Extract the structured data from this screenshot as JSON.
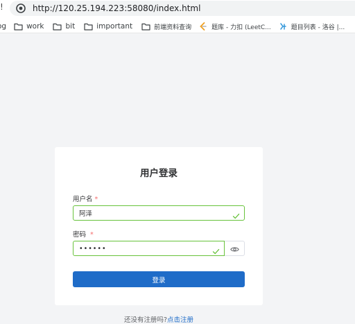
{
  "browser": {
    "left_edge_glyph": "!",
    "url": "http://120.25.194.223:58080/index.html",
    "bookmarks": [
      {
        "label": "og",
        "icon": "none"
      },
      {
        "label": "work",
        "icon": "folder-icon"
      },
      {
        "label": "bit",
        "icon": "folder-icon"
      },
      {
        "label": "important",
        "icon": "folder-icon"
      },
      {
        "label": "前端资料查询",
        "icon": "folder-icon"
      },
      {
        "label": "题库 - 力扣 (LeetC...",
        "icon": "leetcode-icon"
      },
      {
        "label": "题目列表 - 洛谷 |...",
        "icon": "luogu-icon"
      },
      {
        "label": "",
        "icon": "extension-icon"
      }
    ]
  },
  "login": {
    "title": "用户登录",
    "username_label": "用户名",
    "username_value": "阿泽",
    "password_label": "密码",
    "password_value": "123456",
    "required_mark": "*",
    "submit_label": "登录"
  },
  "register": {
    "prompt": "还没有注册吗?",
    "link": "点击注册"
  },
  "colors": {
    "primary": "#1f6cc8",
    "valid": "#67c23a",
    "required": "#f56c6c",
    "page_bg": "#f3f4f6"
  }
}
